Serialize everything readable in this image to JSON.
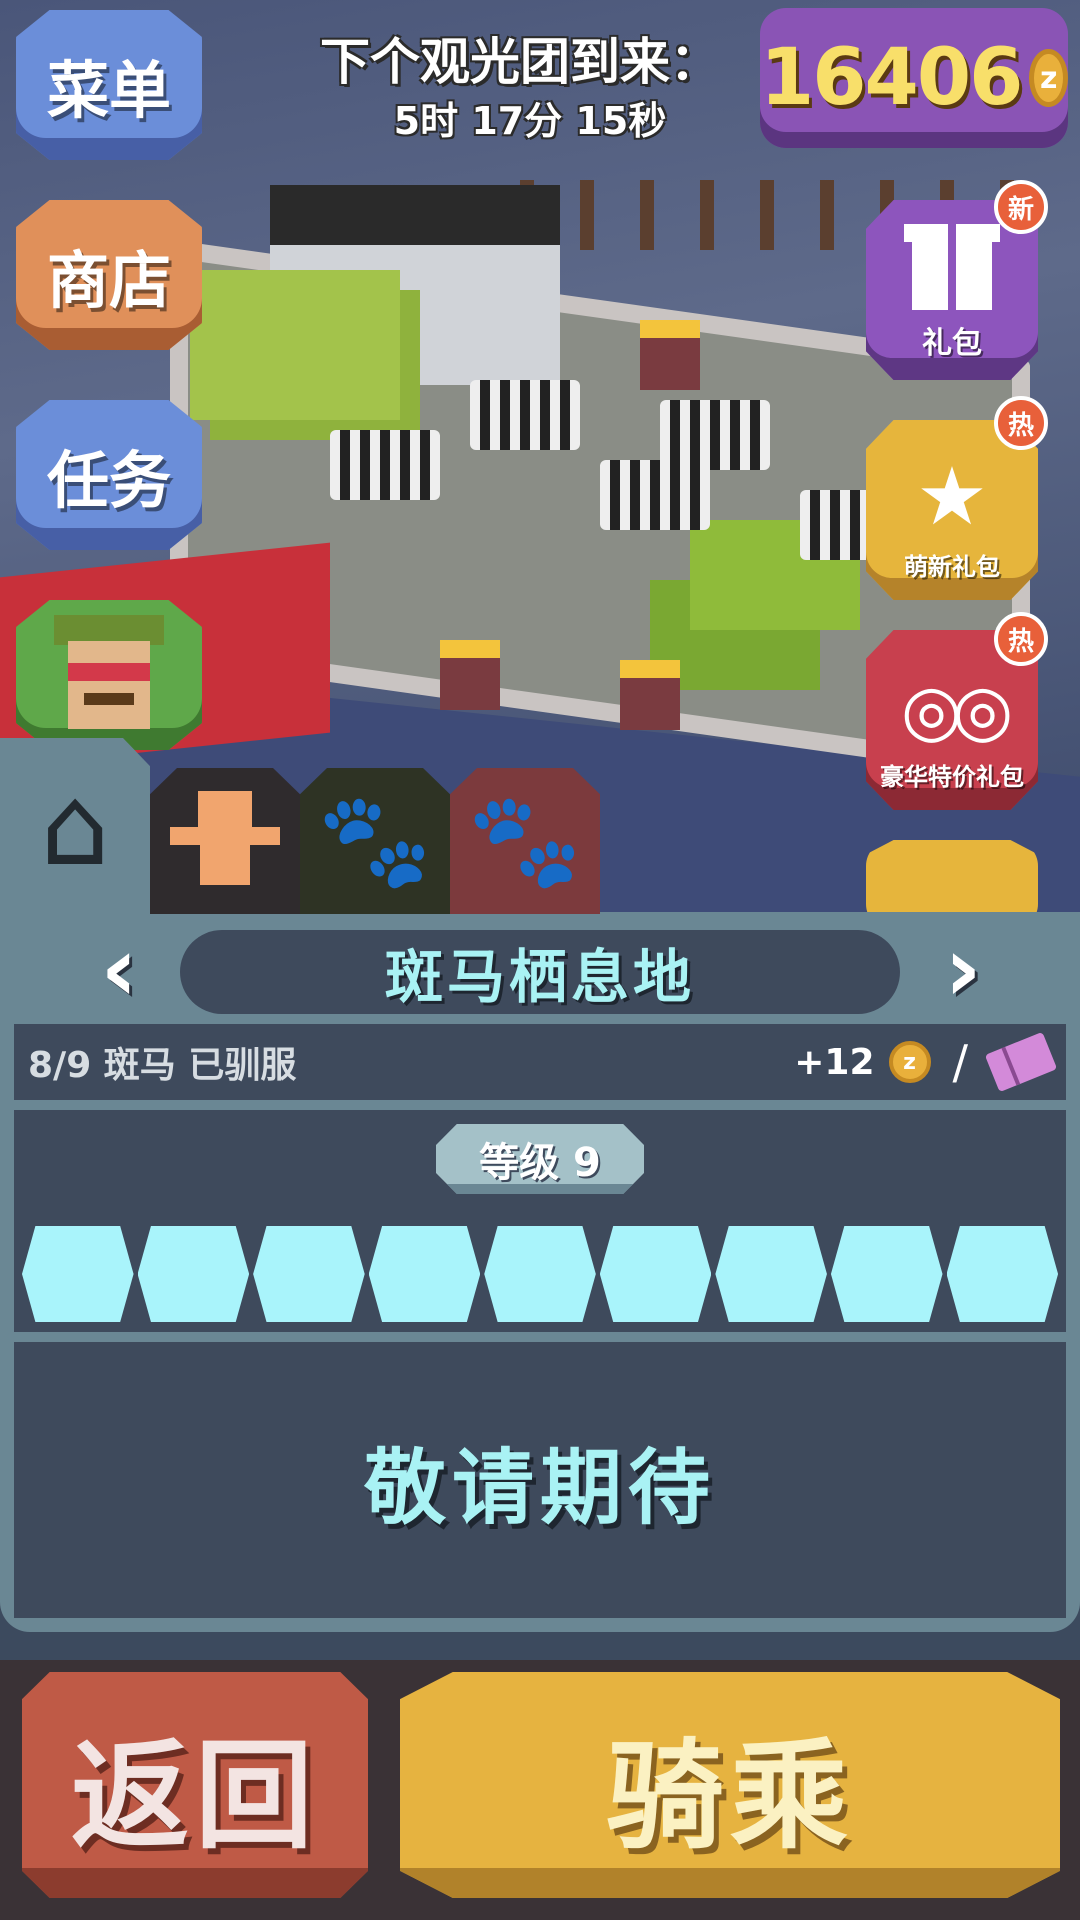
{
  "top": {
    "next_tour_label": "下个观光团到来：",
    "next_tour_time": "5时 17分 15秒"
  },
  "currency": {
    "coins": "16406",
    "coin_symbol": "z"
  },
  "left_menu": {
    "menu": "菜单",
    "shop": "商店",
    "tasks": "任务"
  },
  "right_gifts": {
    "pack_label": "礼包",
    "pack_badge": "新",
    "newbie_label": "萌新礼包",
    "newbie_badge": "热",
    "deluxe_label": "豪华特价礼包",
    "deluxe_badge": "热"
  },
  "tabs": [
    "home-icon",
    "ranger-icon",
    "paw-yellow-icon",
    "paw-white-icon"
  ],
  "habitat": {
    "prev": "‹",
    "next": "›",
    "name": "斑马栖息地",
    "tamed_text": "8/9 斑马 已驯服",
    "income": "+12",
    "slash": "/"
  },
  "level": {
    "label": "等级 9",
    "segments_filled": 9,
    "segments_total": 9
  },
  "coming_soon": "敬请期待",
  "buttons": {
    "back": "返回",
    "ride": "骑乘"
  },
  "colors": {
    "accent_cyan": "#a9f2f4",
    "panel": "#3e4a5c",
    "coin_gold": "#e9b03b",
    "ride_yellow": "#e6b340",
    "back_red": "#bf5a46"
  }
}
